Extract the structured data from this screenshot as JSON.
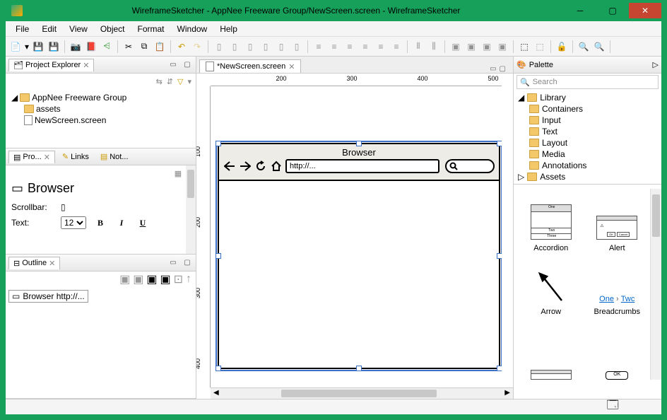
{
  "window": {
    "title": "WireframeSketcher - AppNee Freeware Group/NewScreen.screen - WireframeSketcher"
  },
  "menu": [
    "File",
    "Edit",
    "View",
    "Object",
    "Format",
    "Window",
    "Help"
  ],
  "projectExplorer": {
    "title": "Project Explorer",
    "root": "AppNee Freeware Group",
    "children": [
      "assets",
      "NewScreen.screen"
    ]
  },
  "propertiesPanel": {
    "tab1": "Pro...",
    "tab2": "Links",
    "tab3": "Not...",
    "widgetName": "Browser",
    "scrollbarLabel": "Scrollbar:",
    "textLabel": "Text:",
    "textSize": "12"
  },
  "outline": {
    "title": "Outline",
    "item": "Browser http://..."
  },
  "editor": {
    "tab": "*NewScreen.screen",
    "ruler_h": [
      "200",
      "300",
      "400",
      "500"
    ],
    "ruler_v": [
      "100",
      "200",
      "300",
      "400"
    ],
    "widget": {
      "title": "Browser",
      "url": "http://..."
    }
  },
  "palette": {
    "title": "Palette",
    "searchPlaceholder": "Search",
    "library": "Library",
    "categories": [
      "Containers",
      "Input",
      "Text",
      "Layout",
      "Media",
      "Annotations"
    ],
    "assets": "Assets",
    "items": [
      "Accordion",
      "Alert",
      "Arrow",
      "Breadcrumbs"
    ],
    "breadcrumbSample": [
      "One",
      "Twc"
    ]
  }
}
